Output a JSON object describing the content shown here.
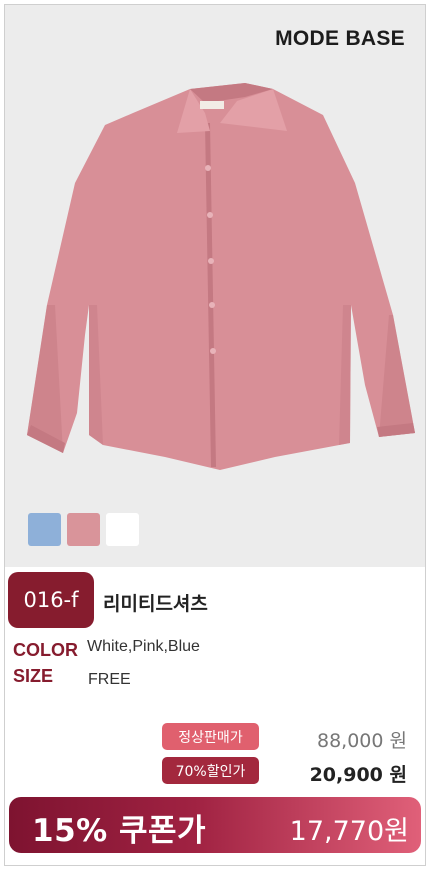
{
  "brand": {
    "logo_text": "MODE BASE"
  },
  "product": {
    "image_alt": "pink corduroy shirt",
    "swatches": [
      {
        "name": "blue-swatch",
        "color": "#8eb0d9"
      },
      {
        "name": "pink-swatch",
        "color": "#d9949a"
      },
      {
        "name": "white-swatch",
        "color": "#ffffff"
      }
    ],
    "code": "016-f",
    "name": "리미티드셔츠",
    "color_label": "COLOR",
    "color_value": "White,Pink,Blue",
    "size_label": "SIZE",
    "size_value": "FREE"
  },
  "pricing": {
    "regular_label": "정상판매가",
    "regular_price": "88,000 원",
    "regular_badge_color": "#e0606e",
    "discount_label": "70%할인가",
    "discount_price": "20,900 원",
    "discount_badge_color": "#a3283d",
    "coupon_label": "15% 쿠폰가",
    "coupon_price": "17,770원"
  },
  "colors": {
    "accent": "#861c2e"
  }
}
